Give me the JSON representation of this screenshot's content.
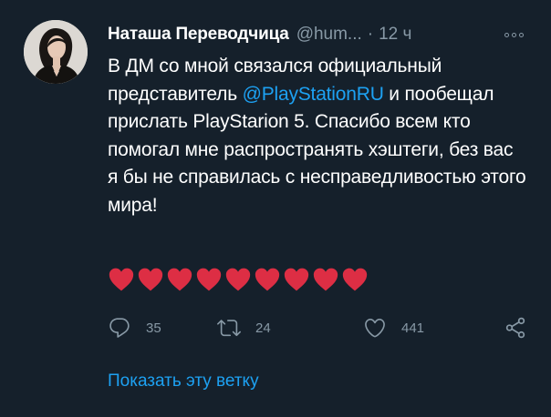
{
  "tweet": {
    "author_name": "Наташа Переводчица",
    "author_handle": "@hum...",
    "separator": "·",
    "time": "12 ч",
    "text_part1": "В ДМ со мной связался официальный представитель ",
    "mention": "@PlayStationRU",
    "text_part2": " и пообещал прислать PlayStarion 5. Спасибо всем кто помогал мне распространять хэштеги, без вас я бы не справилась с несправедливостью этого мира!",
    "hearts": [
      "❤️",
      "❤️",
      "❤️",
      "❤️",
      "❤️",
      "❤️",
      "❤️",
      "❤️",
      "❤️"
    ],
    "reply_count": "35",
    "retweet_count": "24",
    "like_count": "441",
    "show_thread": "Показать эту ветку"
  },
  "colors": {
    "background": "#15202b",
    "text": "#ffffff",
    "muted": "#8899a6",
    "accent": "#1da1f2",
    "heart": "#dd2e44"
  },
  "icons": {
    "reply": "reply-icon",
    "retweet": "retweet-icon",
    "like": "like-icon",
    "share": "share-icon",
    "more": "more-icon"
  }
}
